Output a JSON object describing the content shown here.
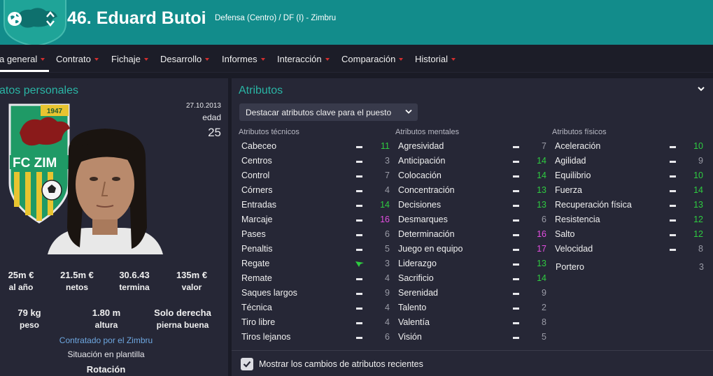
{
  "header": {
    "player_name": "46. Eduard Butoi",
    "position_club": "Defensa (Centro) / DF (I) - Zimbru"
  },
  "nav": {
    "tabs": [
      {
        "label": "a general",
        "active": true
      },
      {
        "label": "Contrato"
      },
      {
        "label": "Fichaje"
      },
      {
        "label": "Desarrollo"
      },
      {
        "label": "Informes"
      },
      {
        "label": "Interacción"
      },
      {
        "label": "Comparación"
      },
      {
        "label": "Historial"
      }
    ]
  },
  "personal": {
    "title": "atos personales",
    "badge_year": "1947",
    "badge_text": "FC ZIM",
    "date": "27.10.2013",
    "age_label": "edad",
    "age_value": "25",
    "finance": [
      {
        "value": "25m €",
        "label": "al año"
      },
      {
        "value": "21.5m €",
        "label": "netos"
      },
      {
        "value": "30.6.43",
        "label": "termina"
      },
      {
        "value": "135m €",
        "label": "valor"
      }
    ],
    "physical": [
      {
        "value": "79 kg",
        "label": "peso"
      },
      {
        "value": "1.80 m",
        "label": "altura"
      },
      {
        "value": "Solo derecha",
        "label": "pierna buena"
      }
    ],
    "contracted_by": "Contratado por el Zimbru",
    "squad_status_label": "Situación en plantilla",
    "squad_status_value": "Rotación"
  },
  "attributes": {
    "title": "Atributos",
    "highlight_select": "Destacar atributos clave para el puesto",
    "show_changes_label": "Mostrar los cambios de atributos recientes",
    "show_changes_checked": true,
    "columns": [
      {
        "header": "Atributos técnicos",
        "items": [
          {
            "name": "Cabeceo",
            "value": "11",
            "color": "#2ecc40"
          },
          {
            "name": "Centros",
            "value": "3",
            "color": "#9a9ba6"
          },
          {
            "name": "Control",
            "value": "7",
            "color": "#9a9ba6"
          },
          {
            "name": "Córners",
            "value": "4",
            "color": "#9a9ba6"
          },
          {
            "name": "Entradas",
            "value": "14",
            "color": "#2ecc40"
          },
          {
            "name": "Marcaje",
            "value": "16",
            "color": "#e24ee0"
          },
          {
            "name": "Pases",
            "value": "6",
            "color": "#9a9ba6"
          },
          {
            "name": "Penaltis",
            "value": "5",
            "color": "#9a9ba6"
          },
          {
            "name": "Regate",
            "value": "3",
            "color": "#9a9ba6",
            "trend": "up"
          },
          {
            "name": "Remate",
            "value": "4",
            "color": "#9a9ba6"
          },
          {
            "name": "Saques largos",
            "value": "9",
            "color": "#9a9ba6"
          },
          {
            "name": "Técnica",
            "value": "4",
            "color": "#9a9ba6"
          },
          {
            "name": "Tiro libre",
            "value": "4",
            "color": "#9a9ba6"
          },
          {
            "name": "Tiros lejanos",
            "value": "6",
            "color": "#9a9ba6"
          }
        ]
      },
      {
        "header": "Atributos mentales",
        "items": [
          {
            "name": "Agresividad",
            "value": "7",
            "color": "#9a9ba6"
          },
          {
            "name": "Anticipación",
            "value": "14",
            "color": "#2ecc40"
          },
          {
            "name": "Colocación",
            "value": "14",
            "color": "#2ecc40"
          },
          {
            "name": "Concentración",
            "value": "13",
            "color": "#2ecc40"
          },
          {
            "name": "Decisiones",
            "value": "13",
            "color": "#2ecc40"
          },
          {
            "name": "Desmarques",
            "value": "6",
            "color": "#9a9ba6"
          },
          {
            "name": "Determinación",
            "value": "16",
            "color": "#e24ee0"
          },
          {
            "name": "Juego en equipo",
            "value": "17",
            "color": "#e24ee0"
          },
          {
            "name": "Liderazgo",
            "value": "13",
            "color": "#2ecc40"
          },
          {
            "name": "Sacrificio",
            "value": "14",
            "color": "#2ecc40"
          },
          {
            "name": "Serenidad",
            "value": "9",
            "color": "#9a9ba6"
          },
          {
            "name": "Talento",
            "value": "2",
            "color": "#9a9ba6"
          },
          {
            "name": "Valentía",
            "value": "8",
            "color": "#9a9ba6"
          },
          {
            "name": "Visión",
            "value": "5",
            "color": "#9a9ba6"
          }
        ]
      },
      {
        "header": "Atributos físicos",
        "items": [
          {
            "name": "Aceleración",
            "value": "10",
            "color": "#2ecc40"
          },
          {
            "name": "Agilidad",
            "value": "9",
            "color": "#9a9ba6"
          },
          {
            "name": "Equilibrio",
            "value": "10",
            "color": "#2ecc40"
          },
          {
            "name": "Fuerza",
            "value": "14",
            "color": "#2ecc40"
          },
          {
            "name": "Recuperación física",
            "value": "13",
            "color": "#2ecc40"
          },
          {
            "name": "Resistencia",
            "value": "12",
            "color": "#2ecc40"
          },
          {
            "name": "Salto",
            "value": "12",
            "color": "#2ecc40"
          },
          {
            "name": "Velocidad",
            "value": "8",
            "color": "#9a9ba6"
          }
        ],
        "extra": {
          "name": "Portero",
          "value": "3"
        }
      }
    ]
  }
}
